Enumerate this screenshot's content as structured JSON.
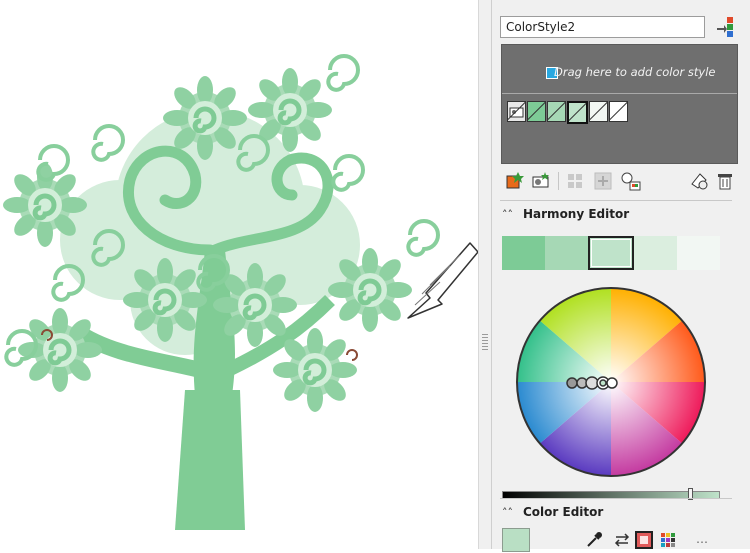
{
  "panel": {
    "style_name": "ColorStyle2",
    "drop_hint": "Drag here to add color style",
    "harmony_chip_count": 6,
    "harmony_editor_title": "Harmony Editor",
    "color_editor_title": "Color Editor",
    "harmony_colors": [
      "#7dcb96",
      "#a6d8b5",
      "#bfe3ca",
      "#dbeedf",
      "#f2f7f3"
    ],
    "selected_color": "#bfe3ca",
    "lightness_slider": 0.88
  },
  "colors": {
    "tree_green": "#80cc95",
    "tree_light": "#a7dab5",
    "tree_pale": "#c9e9d1",
    "drop_zone": "#6f6f6f",
    "panel_bg": "#f0f0f0"
  },
  "icons": {
    "apply": "apply-style-icon",
    "new_style": "new-color-style-icon",
    "new_harmony": "new-harmony-icon",
    "delete": "delete-icon"
  }
}
